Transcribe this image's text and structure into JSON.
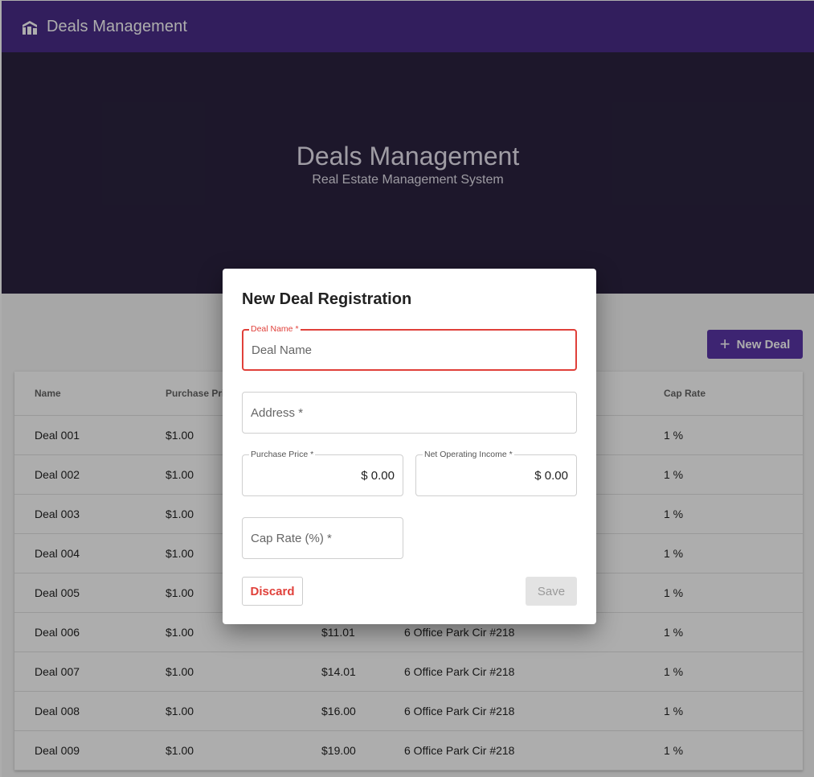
{
  "appbar": {
    "title": "Deals Management"
  },
  "hero": {
    "title": "Deals Management",
    "subtitle": "Real Estate Management System"
  },
  "toolbar": {
    "new_deal_label": "New Deal"
  },
  "table": {
    "headers": {
      "name": "Name",
      "price": "Purchase Price",
      "cap": "Cap Rate"
    },
    "rows": [
      {
        "name": "Deal 001",
        "price": "$1.00",
        "noi": "",
        "addr": "",
        "cap": "1 %"
      },
      {
        "name": "Deal 002",
        "price": "$1.00",
        "noi": "",
        "addr": "",
        "cap": "1 %"
      },
      {
        "name": "Deal 003",
        "price": "$1.00",
        "noi": "",
        "addr": "",
        "cap": "1 %"
      },
      {
        "name": "Deal 004",
        "price": "$1.00",
        "noi": "",
        "addr": "",
        "cap": "1 %"
      },
      {
        "name": "Deal 005",
        "price": "$1.00",
        "noi": "",
        "addr": "",
        "cap": "1 %"
      },
      {
        "name": "Deal 006",
        "price": "$1.00",
        "noi": "$11.01",
        "addr": "6 Office Park Cir #218",
        "cap": "1 %"
      },
      {
        "name": "Deal 007",
        "price": "$1.00",
        "noi": "$14.01",
        "addr": "6 Office Park Cir #218",
        "cap": "1 %"
      },
      {
        "name": "Deal 008",
        "price": "$1.00",
        "noi": "$16.00",
        "addr": "6 Office Park Cir #218",
        "cap": "1 %"
      },
      {
        "name": "Deal 009",
        "price": "$1.00",
        "noi": "$19.00",
        "addr": "6 Office Park Cir #218",
        "cap": "1 %"
      }
    ]
  },
  "dialog": {
    "title": "New Deal Registration",
    "deal_name": {
      "label": "Deal Name *",
      "placeholder": "Deal Name",
      "value": ""
    },
    "address": {
      "placeholder": "Address *",
      "value": ""
    },
    "purchase_price": {
      "label": "Purchase Price *",
      "value": "$ 0.00"
    },
    "noi": {
      "label": "Net Operating Income *",
      "value": "$ 0.00"
    },
    "cap_rate": {
      "placeholder": "Cap Rate (%) *",
      "value": ""
    },
    "discard_label": "Discard",
    "save_label": "Save"
  },
  "colors": {
    "primary": "#4a2d8a",
    "hero": "#2b2340",
    "error": "#e0403a"
  },
  "icons": {
    "logo": "building-icon",
    "add": "plus-icon"
  }
}
